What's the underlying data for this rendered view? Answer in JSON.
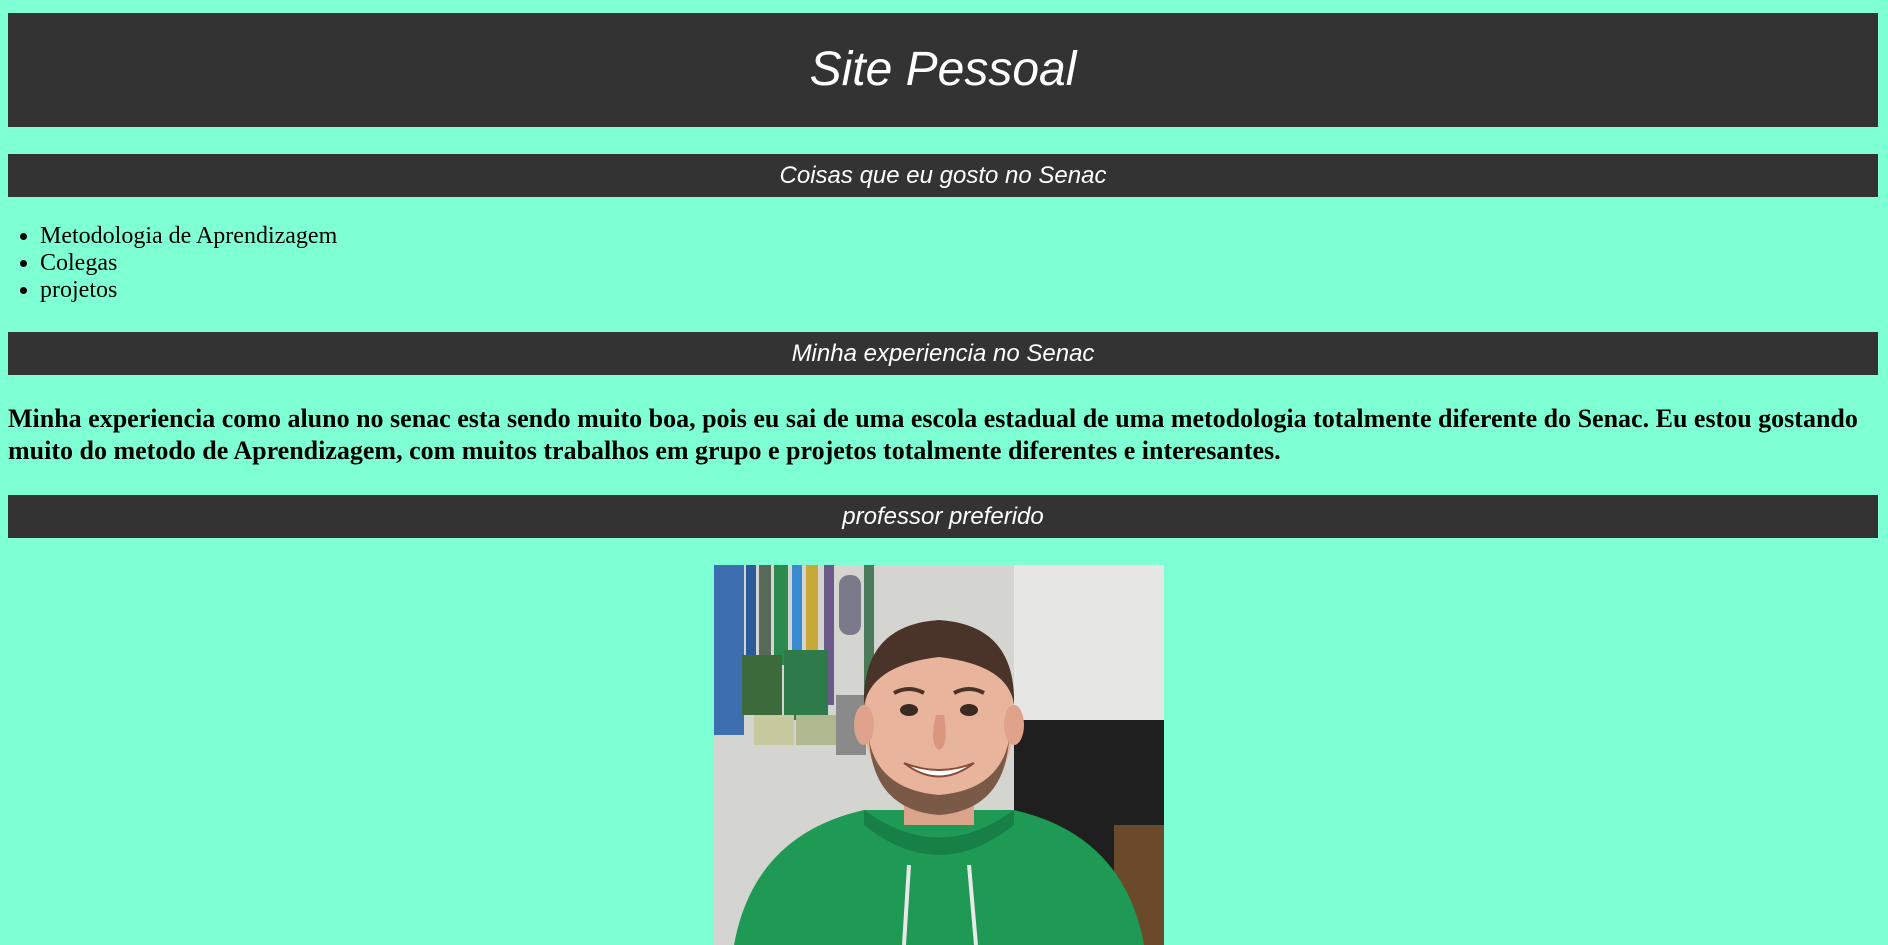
{
  "header": {
    "title": "Site Pessoal"
  },
  "sections": {
    "likes": {
      "title": "Coisas que eu gosto no Senac",
      "items": [
        "Metodologia de Aprendizagem",
        "Colegas",
        "projetos"
      ]
    },
    "experience": {
      "title": "Minha experiencia no Senac",
      "text": "Minha experiencia como aluno no senac esta sendo muito boa, pois eu sai de uma escola estadual de uma metodologia totalmente diferente do Senac. Eu estou gostando muito do metodo de Aprendizagem, com muitos trabalhos em grupo e projetos totalmente diferentes e interesantes."
    },
    "teacher": {
      "title": "professor preferido"
    }
  },
  "colors": {
    "background": "#7fffd4",
    "bar": "#333333",
    "bar_text": "#ffffff"
  }
}
